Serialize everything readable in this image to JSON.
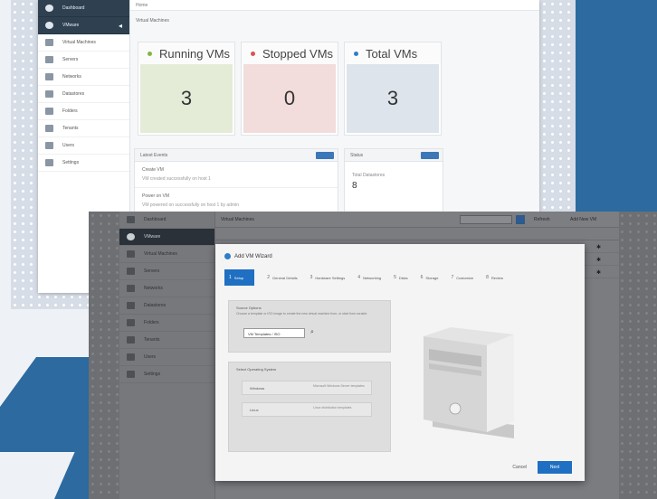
{
  "colors": {
    "accent": "#1f6fc2",
    "sidebar_dark": "#2f4151",
    "running": "#7fb83f",
    "stopped": "#d9534f",
    "total": "#2f7ec7",
    "tile_running_bg": "#e4ecd8",
    "tile_stopped_bg": "#f2dcdc",
    "tile_total_bg": "#dde4ec"
  },
  "back_window": {
    "breadcrumb": "Home",
    "subtitle": "Virtual Machines",
    "sidebar": [
      {
        "label": "Dashboard",
        "icon": "dashboard-icon",
        "dark": true
      },
      {
        "label": "VMware",
        "icon": "cloud-icon",
        "dark": true
      },
      {
        "label": "Virtual Machines",
        "icon": "vm-icon"
      },
      {
        "label": "Servers",
        "icon": "server-icon"
      },
      {
        "label": "Networks",
        "icon": "network-icon"
      },
      {
        "label": "Datastores",
        "icon": "datastore-icon"
      },
      {
        "label": "Folders",
        "icon": "folder-icon"
      },
      {
        "label": "Tenants",
        "icon": "tenant-icon"
      },
      {
        "label": "Users",
        "icon": "user-icon"
      },
      {
        "label": "Settings",
        "icon": "gear-icon"
      }
    ],
    "tiles": {
      "running": {
        "label": "Running VMs",
        "value": "3"
      },
      "stopped": {
        "label": "Stopped VMs",
        "value": "0"
      },
      "total": {
        "label": "Total VMs",
        "value": "3"
      }
    },
    "events_panel": {
      "title": "Latest Events",
      "items": [
        {
          "title": "Create VM",
          "detail": "VM created successfully on host 1"
        },
        {
          "title": "Power on VM",
          "detail": "VM powered on successfully on host 1 by admin"
        }
      ]
    },
    "stats_panel": {
      "title": "Status",
      "label": "Total Datastores",
      "value": "8"
    }
  },
  "front_window": {
    "topbar": {
      "label": "Virtual Machines",
      "link1": "Refresh",
      "link2": "Add New VM"
    },
    "dialog": {
      "title": "Add VM Wizard",
      "steps": [
        {
          "num": "1",
          "label": "Setup",
          "active": true
        },
        {
          "num": "2",
          "label": "General Details"
        },
        {
          "num": "3",
          "label": "Hardware Settings"
        },
        {
          "num": "4",
          "label": "Networking"
        },
        {
          "num": "5",
          "label": "Disks"
        },
        {
          "num": "6",
          "label": "Storage"
        },
        {
          "num": "7",
          "label": "Customize"
        },
        {
          "num": "8",
          "label": "Review"
        }
      ],
      "source": {
        "heading": "Source Options",
        "hint": "Choose a template or ISO image to create the new virtual machine from, or start from scratch.",
        "select_value": "VM Templates / ISO",
        "search_icon": "search-icon"
      },
      "os_options": {
        "heading": "Select Operating System",
        "items": [
          {
            "label": "Windows",
            "desc": "Microsoft Windows Server templates"
          },
          {
            "label": "Linux",
            "desc": "Linux distribution templates"
          }
        ]
      },
      "cancel_label": "Cancel",
      "next_label": "Next"
    }
  }
}
